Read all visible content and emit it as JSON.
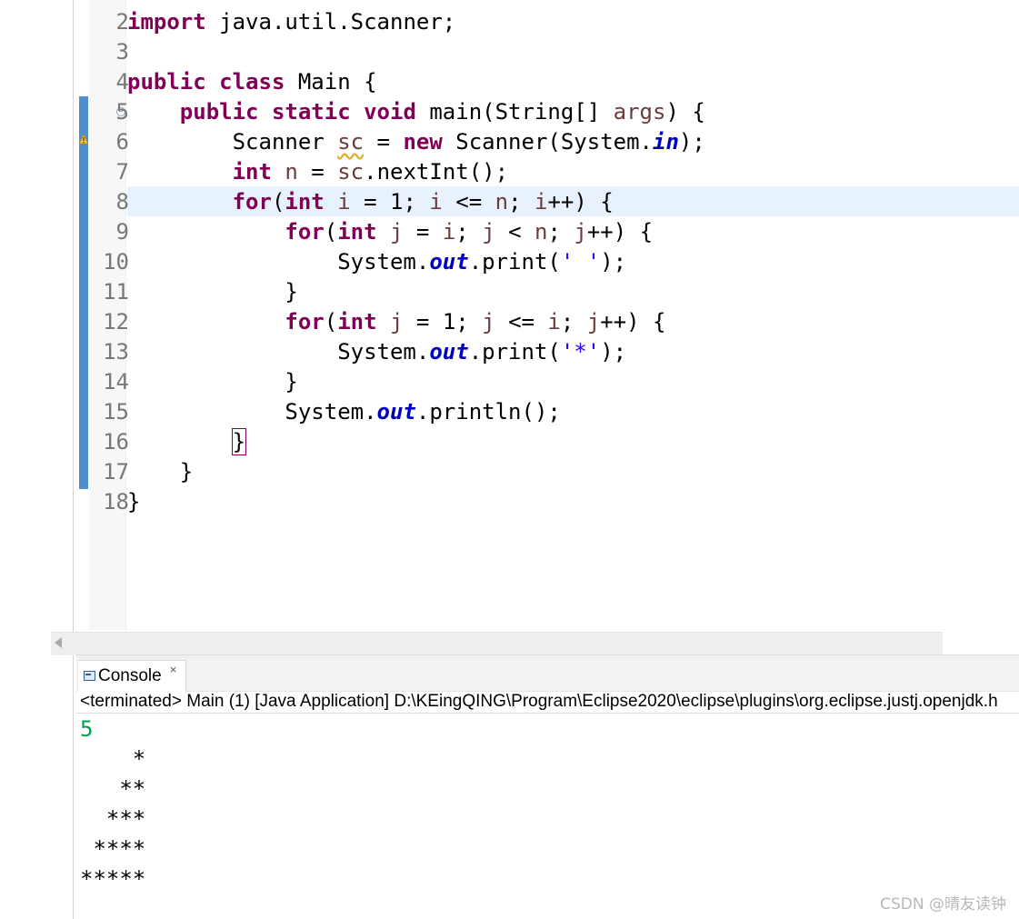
{
  "editor": {
    "line_numbers": [
      "2",
      "3",
      "4",
      "5",
      "6",
      "7",
      "8",
      "9",
      "10",
      "11",
      "12",
      "13",
      "14",
      "15",
      "16",
      "17",
      "18"
    ],
    "lines": [
      {
        "n": "2",
        "parts": [
          {
            "t": "import",
            "c": "kw"
          },
          {
            "t": " java.util.Scanner;",
            "c": ""
          }
        ]
      },
      {
        "n": "3",
        "parts": []
      },
      {
        "n": "4",
        "parts": [
          {
            "t": "public",
            "c": "kw"
          },
          {
            "t": " ",
            "c": ""
          },
          {
            "t": "class",
            "c": "kw"
          },
          {
            "t": " Main {",
            "c": ""
          }
        ]
      },
      {
        "n": "5",
        "parts": [
          {
            "t": "    ",
            "c": ""
          },
          {
            "t": "public",
            "c": "kw"
          },
          {
            "t": " ",
            "c": ""
          },
          {
            "t": "static",
            "c": "kw"
          },
          {
            "t": " ",
            "c": ""
          },
          {
            "t": "void",
            "c": "kw"
          },
          {
            "t": " main(String[] ",
            "c": ""
          },
          {
            "t": "args",
            "c": "var"
          },
          {
            "t": ") {",
            "c": ""
          }
        ]
      },
      {
        "n": "6",
        "parts": [
          {
            "t": "        Scanner ",
            "c": ""
          },
          {
            "t": "sc",
            "c": "var warn-underline"
          },
          {
            "t": " = ",
            "c": ""
          },
          {
            "t": "new",
            "c": "kw"
          },
          {
            "t": " Scanner(System.",
            "c": ""
          },
          {
            "t": "in",
            "c": "static-field"
          },
          {
            "t": ");",
            "c": ""
          }
        ]
      },
      {
        "n": "7",
        "parts": [
          {
            "t": "        ",
            "c": ""
          },
          {
            "t": "int",
            "c": "kw"
          },
          {
            "t": " ",
            "c": ""
          },
          {
            "t": "n",
            "c": "var"
          },
          {
            "t": " = ",
            "c": ""
          },
          {
            "t": "sc",
            "c": "var"
          },
          {
            "t": ".nextInt();",
            "c": ""
          }
        ]
      },
      {
        "n": "8",
        "parts": [
          {
            "t": "        ",
            "c": ""
          },
          {
            "t": "for",
            "c": "kw"
          },
          {
            "t": "(",
            "c": ""
          },
          {
            "t": "int",
            "c": "kw"
          },
          {
            "t": " ",
            "c": ""
          },
          {
            "t": "i",
            "c": "var"
          },
          {
            "t": " = 1; ",
            "c": ""
          },
          {
            "t": "i",
            "c": "var"
          },
          {
            "t": " <= ",
            "c": ""
          },
          {
            "t": "n",
            "c": "var"
          },
          {
            "t": "; ",
            "c": ""
          },
          {
            "t": "i",
            "c": "var"
          },
          {
            "t": "++) {",
            "c": ""
          }
        ]
      },
      {
        "n": "9",
        "parts": [
          {
            "t": "            ",
            "c": ""
          },
          {
            "t": "for",
            "c": "kw"
          },
          {
            "t": "(",
            "c": ""
          },
          {
            "t": "int",
            "c": "kw"
          },
          {
            "t": " ",
            "c": ""
          },
          {
            "t": "j",
            "c": "var"
          },
          {
            "t": " = ",
            "c": ""
          },
          {
            "t": "i",
            "c": "var"
          },
          {
            "t": "; ",
            "c": ""
          },
          {
            "t": "j",
            "c": "var"
          },
          {
            "t": " < ",
            "c": ""
          },
          {
            "t": "n",
            "c": "var"
          },
          {
            "t": "; ",
            "c": ""
          },
          {
            "t": "j",
            "c": "var"
          },
          {
            "t": "++) {",
            "c": ""
          }
        ]
      },
      {
        "n": "10",
        "parts": [
          {
            "t": "                System.",
            "c": ""
          },
          {
            "t": "out",
            "c": "static-field"
          },
          {
            "t": ".print(",
            "c": ""
          },
          {
            "t": "' '",
            "c": "str"
          },
          {
            "t": ");",
            "c": ""
          }
        ]
      },
      {
        "n": "11",
        "parts": [
          {
            "t": "            }",
            "c": ""
          }
        ]
      },
      {
        "n": "12",
        "parts": [
          {
            "t": "            ",
            "c": ""
          },
          {
            "t": "for",
            "c": "kw"
          },
          {
            "t": "(",
            "c": ""
          },
          {
            "t": "int",
            "c": "kw"
          },
          {
            "t": " ",
            "c": ""
          },
          {
            "t": "j",
            "c": "var"
          },
          {
            "t": " = 1; ",
            "c": ""
          },
          {
            "t": "j",
            "c": "var"
          },
          {
            "t": " <= ",
            "c": ""
          },
          {
            "t": "i",
            "c": "var"
          },
          {
            "t": "; ",
            "c": ""
          },
          {
            "t": "j",
            "c": "var"
          },
          {
            "t": "++) {",
            "c": ""
          }
        ]
      },
      {
        "n": "13",
        "parts": [
          {
            "t": "                System.",
            "c": ""
          },
          {
            "t": "out",
            "c": "static-field"
          },
          {
            "t": ".print(",
            "c": ""
          },
          {
            "t": "'*'",
            "c": "str"
          },
          {
            "t": ");",
            "c": ""
          }
        ]
      },
      {
        "n": "14",
        "parts": [
          {
            "t": "            }",
            "c": ""
          }
        ]
      },
      {
        "n": "15",
        "parts": [
          {
            "t": "            System.",
            "c": ""
          },
          {
            "t": "out",
            "c": "static-field"
          },
          {
            "t": ".println();",
            "c": ""
          }
        ]
      },
      {
        "n": "16",
        "parts": [
          {
            "t": "        ",
            "c": ""
          },
          {
            "t": "}",
            "c": "bracket-box"
          }
        ]
      },
      {
        "n": "17",
        "parts": [
          {
            "t": "    }",
            "c": ""
          }
        ]
      },
      {
        "n": "18",
        "parts": [
          {
            "t": "}",
            "c": ""
          }
        ]
      }
    ],
    "current_line": "8",
    "colors": {
      "keyword": "#7f0055",
      "static_field": "#0000c0",
      "local_var": "#6a3e3e",
      "string": "#2a00ff",
      "current_line_bg": "#e8f2fe",
      "quick_diff": "#4e8fcf"
    }
  },
  "console": {
    "tab_label": "Console",
    "close_icon": "×",
    "status": "<terminated> Main (1) [Java Application] D:\\KEingQING\\Program\\Eclipse2020\\eclipse\\plugins\\org.eclipse.justj.openjdk.h",
    "input_echo": "5",
    "output_lines": [
      "    *",
      "   **",
      "  ***",
      " ****",
      "*****"
    ],
    "input_color": "#00a050"
  },
  "watermark": "CSDN @晴友读钟"
}
